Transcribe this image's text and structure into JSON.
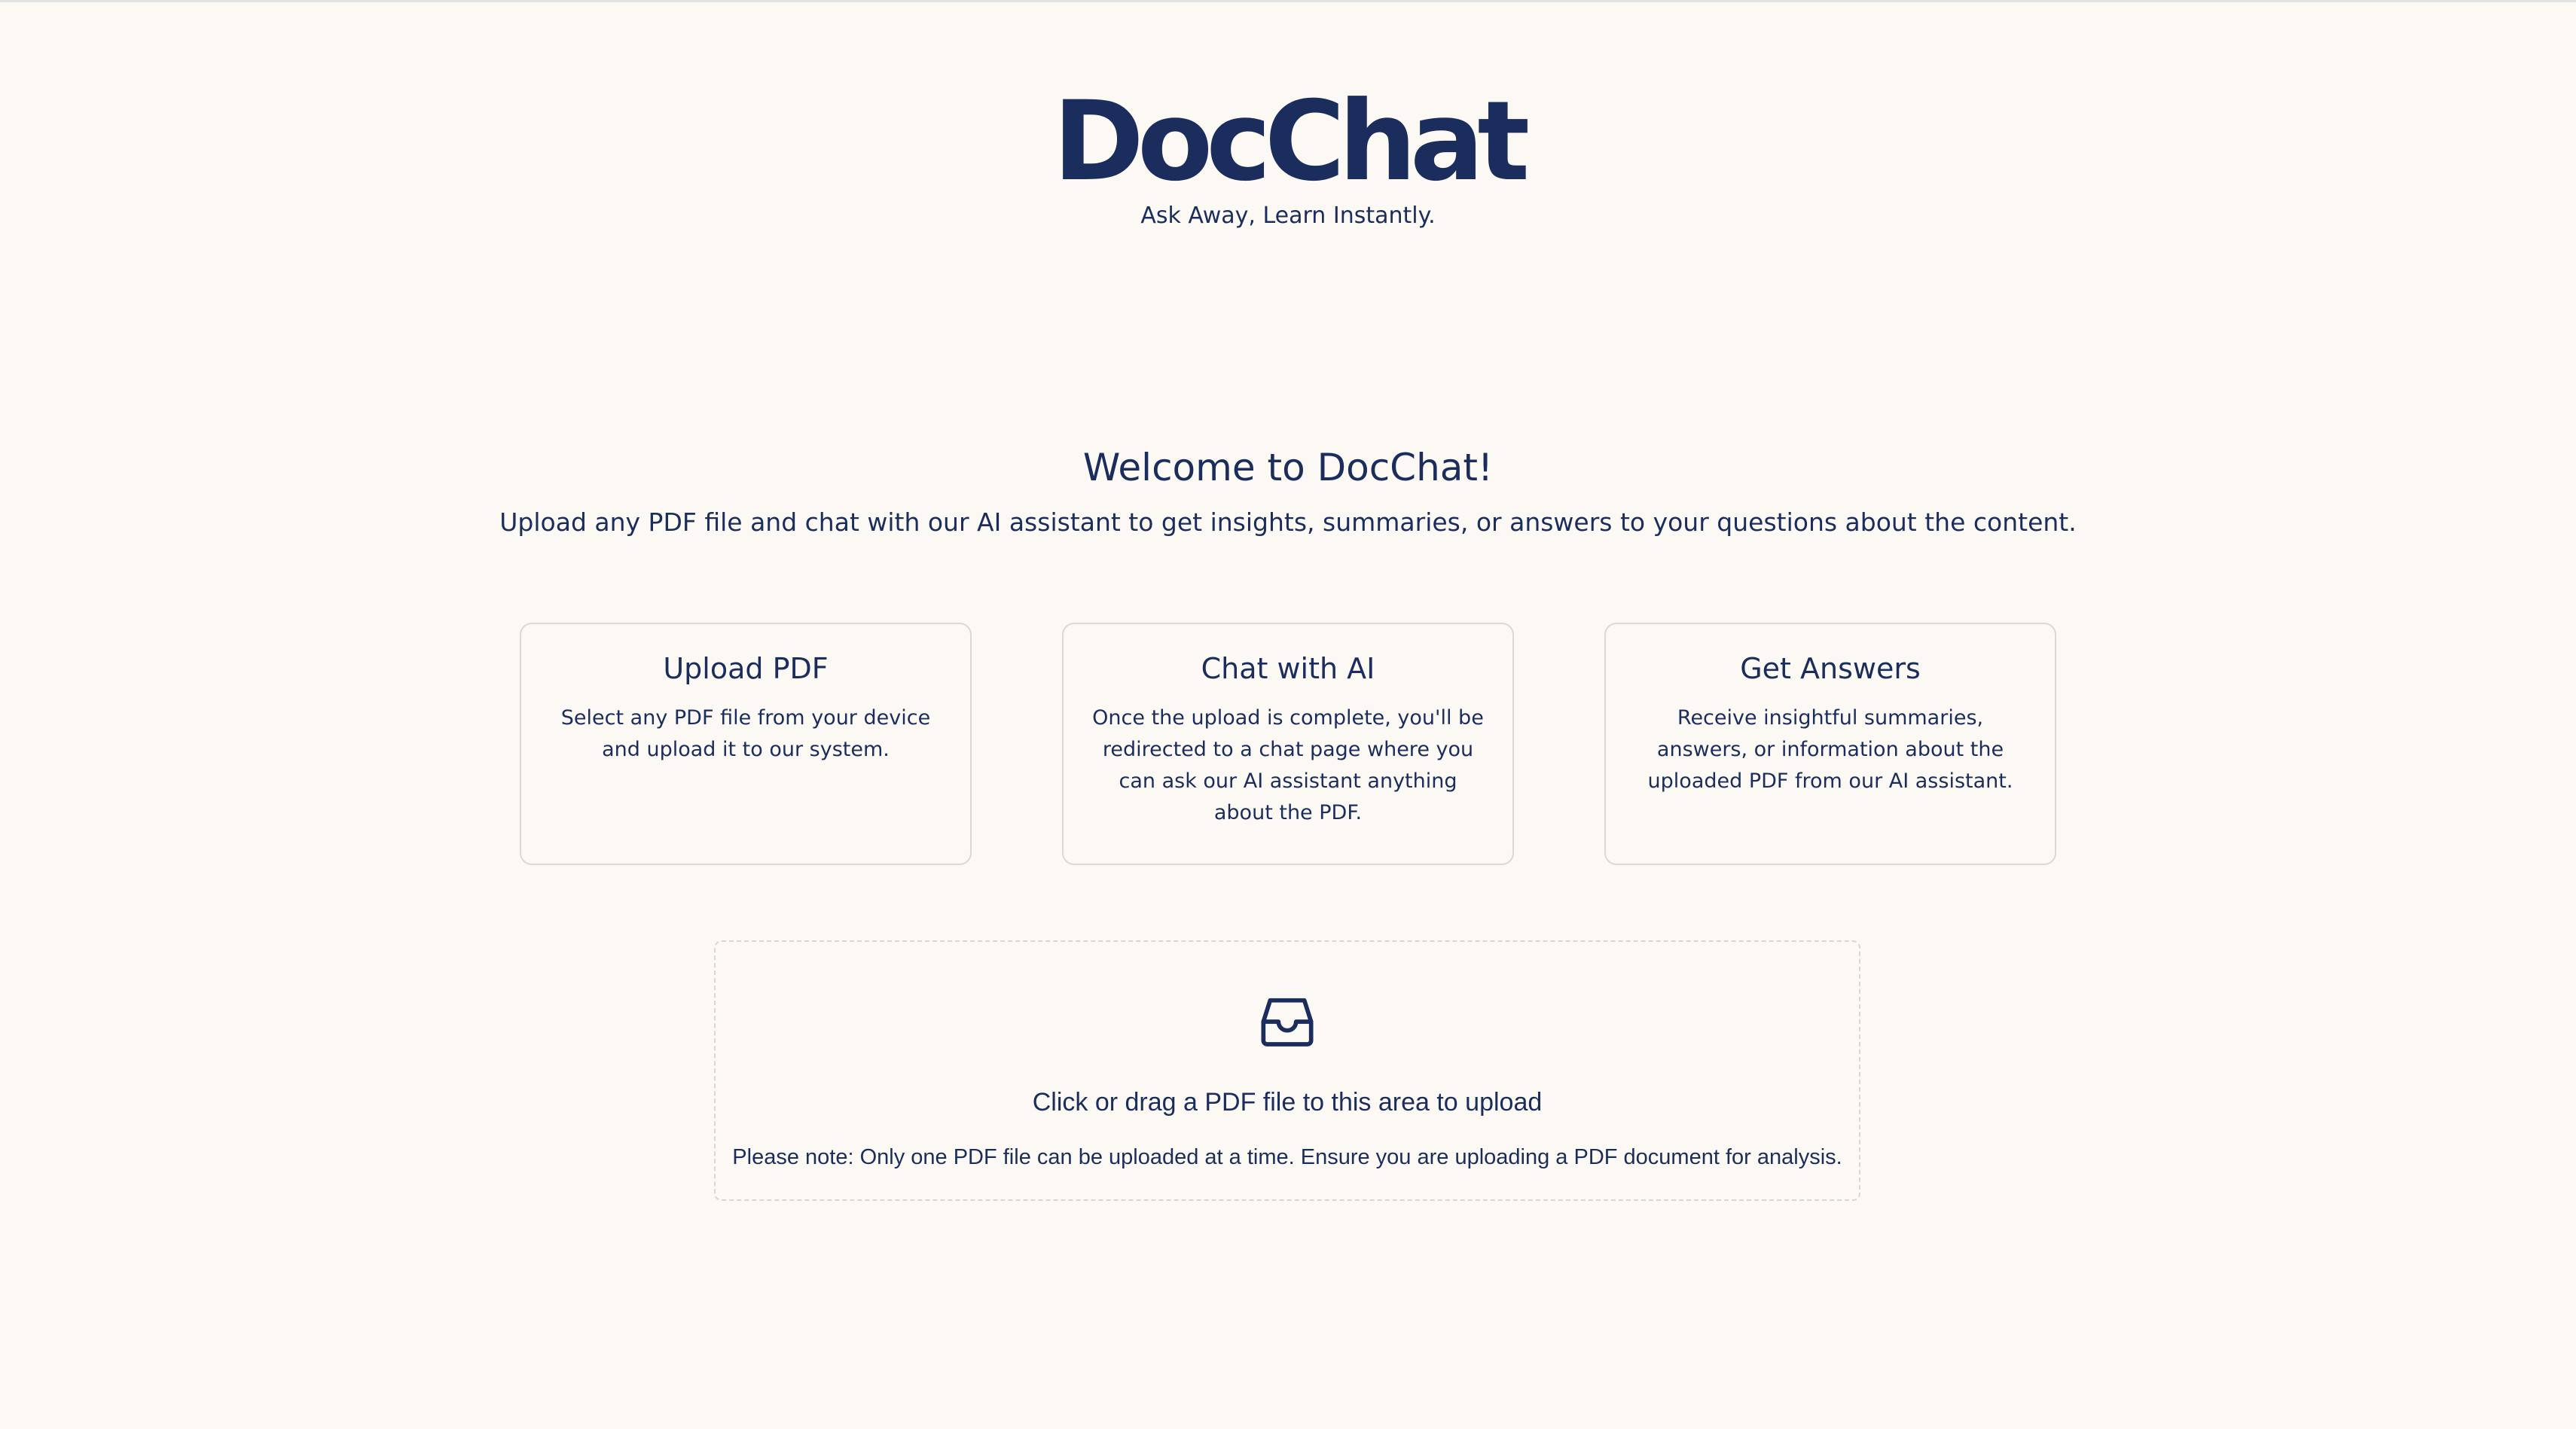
{
  "header": {
    "logo": "DocChat",
    "tagline": "Ask Away, Learn Instantly."
  },
  "welcome": {
    "title": "Welcome to DocChat!",
    "description": "Upload any PDF file and chat with our AI assistant to get insights, summaries, or answers to your questions about the content."
  },
  "cards": [
    {
      "title": "Upload PDF",
      "text": "Select any PDF file from your device and upload it to our system."
    },
    {
      "title": "Chat with AI",
      "text": "Once the upload is complete, you'll be redirected to a chat page where you can ask our AI assistant anything about the PDF."
    },
    {
      "title": "Get Answers",
      "text": "Receive insightful summaries, answers, or information about the uploaded PDF from our AI assistant."
    }
  ],
  "upload": {
    "icon": "inbox-icon",
    "title": "Click or drag a PDF file to this area to upload",
    "note": "Please note: Only one PDF file can be uploaded at a time. Ensure you are uploading a PDF document for analysis."
  },
  "colors": {
    "background": "#fcf9f5",
    "primary": "#1b2d5c",
    "border": "#dcd9d4"
  }
}
